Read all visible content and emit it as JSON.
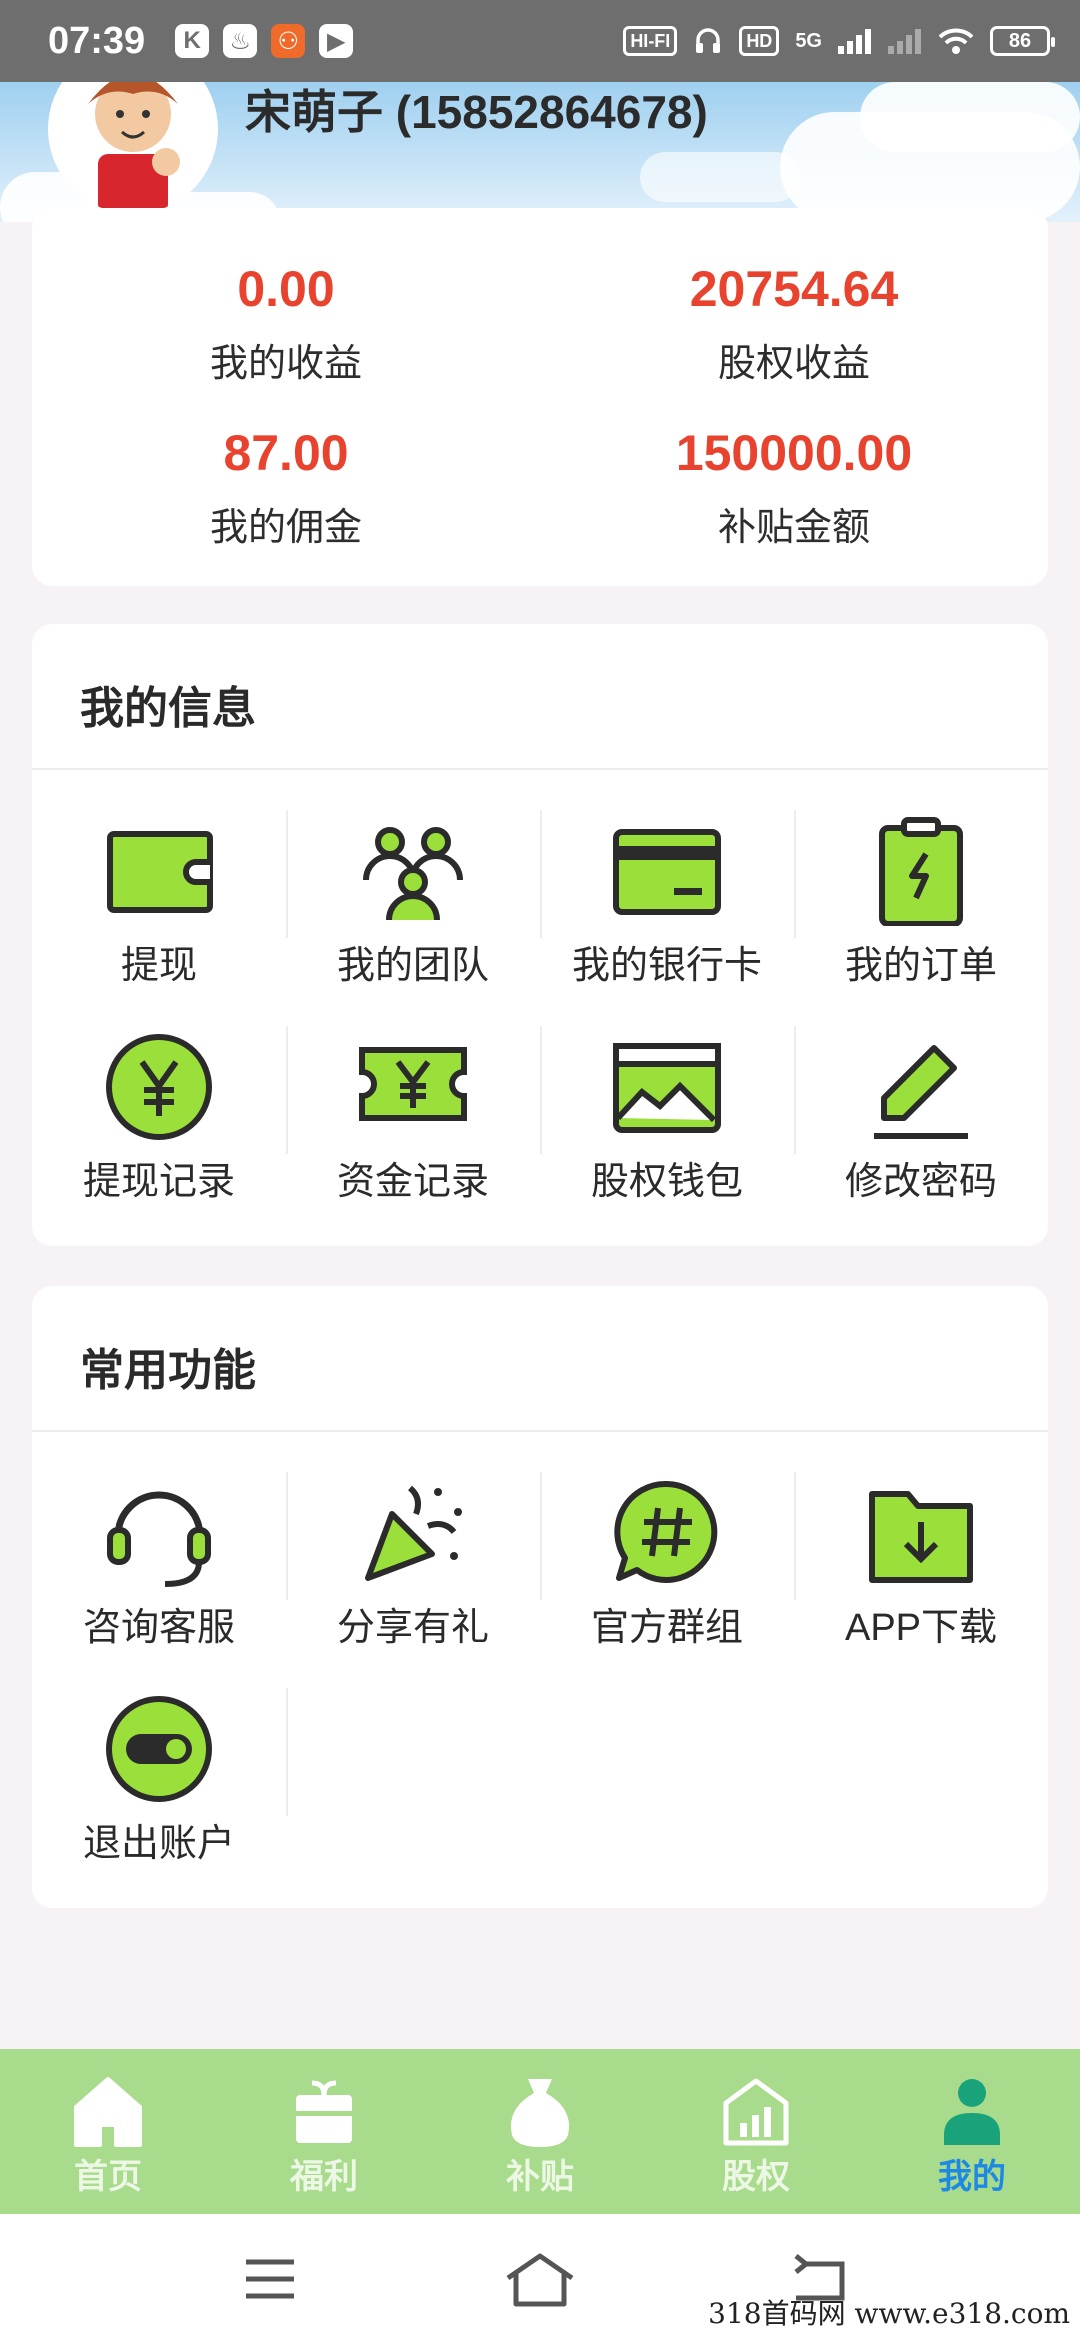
{
  "status_bar": {
    "time": "07:39",
    "left_icons": [
      "K",
      "♨",
      "⚇",
      "▶"
    ],
    "hifi": "HI-FI",
    "hd": "HD",
    "network": "5G",
    "battery": "86"
  },
  "header": {
    "username": "宋萌子 (15852864678)"
  },
  "stats": [
    {
      "value": "0.00",
      "label": "我的收益"
    },
    {
      "value": "20754.64",
      "label": "股权收益"
    },
    {
      "value": "87.00",
      "label": "我的佣金"
    },
    {
      "value": "150000.00",
      "label": "补贴金额"
    }
  ],
  "my_info": {
    "title": "我的信息",
    "items": [
      {
        "label": "提现",
        "icon": "wallet-icon"
      },
      {
        "label": "我的团队",
        "icon": "team-icon"
      },
      {
        "label": "我的银行卡",
        "icon": "bank-card-icon"
      },
      {
        "label": "我的订单",
        "icon": "order-clipboard-icon"
      },
      {
        "label": "提现记录",
        "icon": "yen-coin-icon"
      },
      {
        "label": "资金记录",
        "icon": "yen-ticket-icon"
      },
      {
        "label": "股权钱包",
        "icon": "chart-wallet-icon"
      },
      {
        "label": "修改密码",
        "icon": "pencil-icon"
      }
    ]
  },
  "common_functions": {
    "title": "常用功能",
    "items": [
      {
        "label": "咨询客服",
        "icon": "headset-icon"
      },
      {
        "label": "分享有礼",
        "icon": "party-popper-icon"
      },
      {
        "label": "官方群组",
        "icon": "hashtag-chat-icon"
      },
      {
        "label": "APP下载",
        "icon": "download-folder-icon"
      },
      {
        "label": "退出账户",
        "icon": "toggle-icon"
      }
    ]
  },
  "tabbar": [
    {
      "label": "首页",
      "icon": "home-icon",
      "active": false
    },
    {
      "label": "福利",
      "icon": "gift-box-icon",
      "active": false
    },
    {
      "label": "补贴",
      "icon": "money-bag-icon",
      "active": false
    },
    {
      "label": "股权",
      "icon": "stock-building-icon",
      "active": false
    },
    {
      "label": "我的",
      "icon": "user-icon",
      "active": true
    }
  ],
  "watermark": "318首码网 www.e318.com",
  "colors": {
    "accent_green": "#9be03a",
    "tab_green": "#a9db8c",
    "value_red": "#e8432e",
    "active_blue": "#1e88e5"
  }
}
